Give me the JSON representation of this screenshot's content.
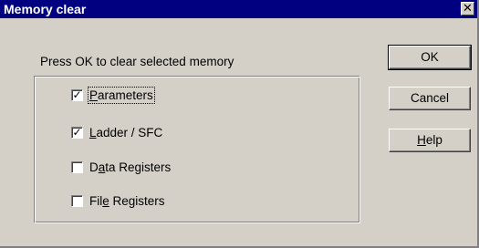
{
  "dialog": {
    "title": "Memory clear",
    "close_symbol": "✕",
    "prompt": "Press OK to clear selected memory"
  },
  "options": [
    {
      "pre": "",
      "accel": "P",
      "post": "arameters",
      "checked": true
    },
    {
      "pre": "",
      "accel": "L",
      "post": "adder / SFC",
      "checked": true
    },
    {
      "pre": "D",
      "accel": "a",
      "post": "ta Registers",
      "checked": false
    },
    {
      "pre": "Fil",
      "accel": "e",
      "post": " Registers",
      "checked": false
    }
  ],
  "buttons": {
    "ok": "OK",
    "cancel": "Cancel",
    "help_accel": "H",
    "help_rest": "elp"
  },
  "check_mark": "✓"
}
